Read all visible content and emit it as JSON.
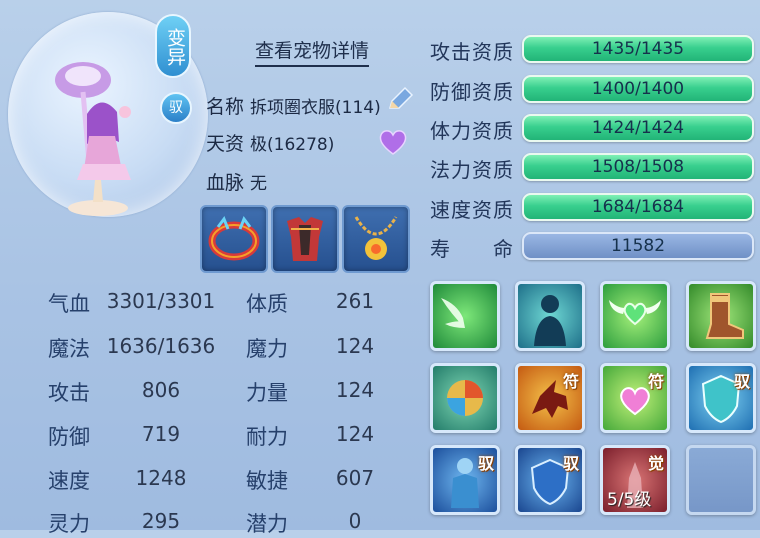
{
  "header": {
    "badge_mutate": "变异",
    "badge_tame": "驭",
    "view_details": "查看宠物详情"
  },
  "info": {
    "name_label": "名称",
    "name_value": "拆项圈衣服(114)",
    "talent_label": "天资",
    "talent_value": "极(16278)",
    "bloodline_label": "血脉",
    "bloodline_value": "无"
  },
  "stats": [
    {
      "label": "气血",
      "value": "3301/3301",
      "label2": "体质",
      "value2": "261"
    },
    {
      "label": "魔法",
      "value": "1636/1636",
      "label2": "魔力",
      "value2": "124"
    },
    {
      "label": "攻击",
      "value": "806",
      "label2": "力量",
      "value2": "124"
    },
    {
      "label": "防御",
      "value": "719",
      "label2": "耐力",
      "value2": "124"
    },
    {
      "label": "速度",
      "value": "1248",
      "label2": "敏捷",
      "value2": "607"
    },
    {
      "label": "灵力",
      "value": "295",
      "label2": "潜力",
      "value2": "0"
    }
  ],
  "aptitudes": [
    {
      "label": "攻击资质",
      "value": "1435/1435"
    },
    {
      "label": "防御资质",
      "value": "1400/1400"
    },
    {
      "label": "体力资质",
      "value": "1424/1424"
    },
    {
      "label": "法力资质",
      "value": "1508/1508"
    },
    {
      "label": "速度资质",
      "value": "1684/1684"
    },
    {
      "label": "寿　　命",
      "value": "11582"
    }
  ],
  "skills": [
    {
      "icon": "wings-skill-icon",
      "tag": ""
    },
    {
      "icon": "silhouette-skill-icon",
      "tag": ""
    },
    {
      "icon": "heart-wings-skill-icon",
      "tag": ""
    },
    {
      "icon": "boot-skill-icon",
      "tag": ""
    },
    {
      "icon": "elements-orb-skill-icon",
      "tag": ""
    },
    {
      "icon": "beast-skill-icon",
      "tag": "符"
    },
    {
      "icon": "heart-shield-skill-icon",
      "tag": "符"
    },
    {
      "icon": "shield-skill-icon",
      "tag": "驭"
    },
    {
      "icon": "armored-figure-skill-icon",
      "tag": "驭"
    },
    {
      "icon": "blue-shield-skill-icon",
      "tag": "驭"
    },
    {
      "icon": "awakened-skill-icon",
      "tag": "觉",
      "level": "5/5级"
    },
    {
      "icon": "empty-skill-slot",
      "tag": ""
    }
  ],
  "colors": {
    "background": "#a9c3e4",
    "bar_green": "#38cf8e",
    "bar_blue": "#6f90c6"
  }
}
